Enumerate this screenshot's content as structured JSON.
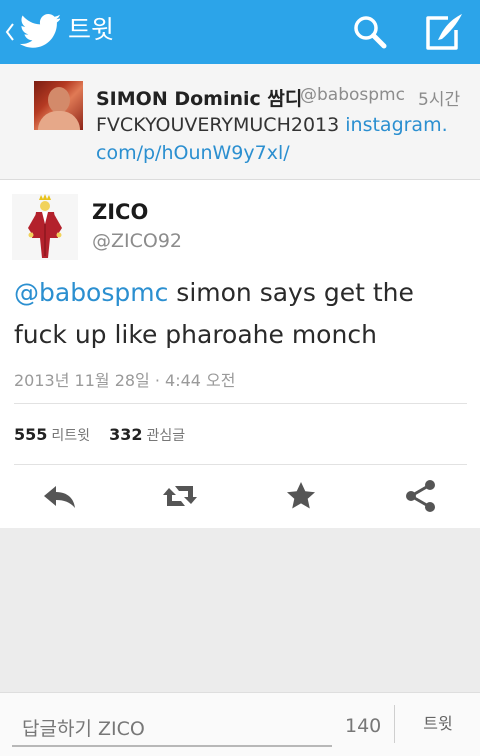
{
  "header": {
    "title": "트윗",
    "bar_color": "#2ca4e9",
    "icons": [
      "back-chevron-icon",
      "twitter-bird-icon",
      "search-icon",
      "compose-icon"
    ]
  },
  "parent_tweet": {
    "name": "SIMON Dominic 쌈디",
    "handle": "@babospmc",
    "time": "5시간",
    "text_plain": "FVCKYOUVERYMUCH2013 ",
    "link_part1": "instagram.",
    "link_part2": "com/p/hOunW9y7xl/"
  },
  "tweet": {
    "name": "ZICO",
    "handle": "@ZICO92",
    "mention": "@babospmc",
    "text": " simon says get the fuck up like pharoahe monch",
    "date": "2013년 11월 28일 · 4:44 오전",
    "retweets_count": "555",
    "retweets_label": "리트윗",
    "favorites_count": "332",
    "favorites_label": "관심글",
    "link_color": "#2b8fd0"
  },
  "actions": [
    "reply-icon",
    "retweet-icon",
    "favorite-star-icon",
    "share-icon"
  ],
  "reply": {
    "placeholder": "답글하기 ZICO",
    "char_count": "140",
    "tweet_button": "트윗"
  }
}
